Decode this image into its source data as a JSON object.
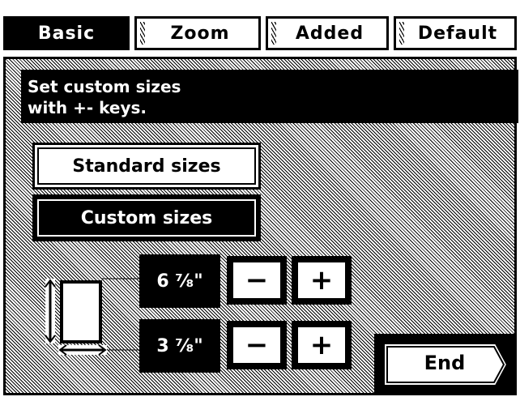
{
  "tabs": [
    {
      "label": "Basic",
      "active": true
    },
    {
      "label": "Zoom",
      "active": false
    },
    {
      "label": "Added",
      "active": false
    },
    {
      "label": "Default",
      "active": false
    }
  ],
  "message": {
    "line1": "Set custom sizes",
    "line2": "with +- keys."
  },
  "buttons": {
    "standard": "Standard sizes",
    "custom": "Custom sizes",
    "end": "End"
  },
  "size": {
    "length": "6 ⁷⁄₈\"",
    "width": "3 ⁷⁄₈\""
  },
  "stepper": {
    "minus": "−",
    "plus": "+"
  }
}
